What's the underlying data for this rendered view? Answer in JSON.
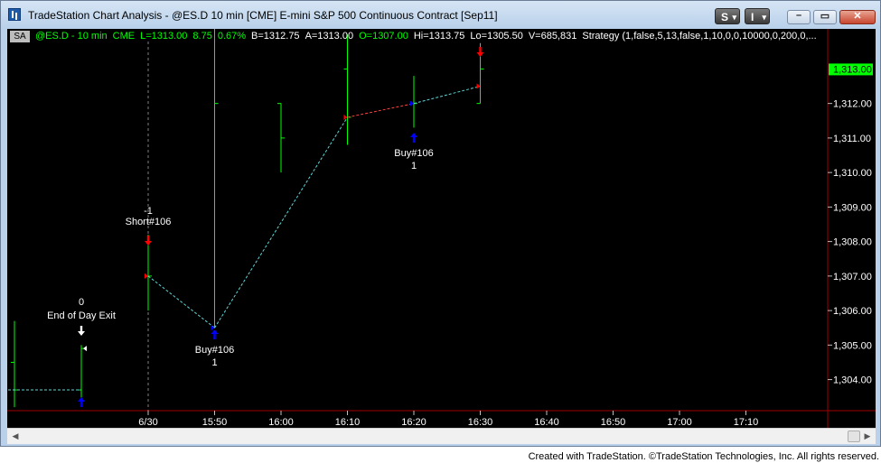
{
  "window": {
    "title": "TradeStation Chart Analysis - @ES.D 10 min [CME] E-mini S&P 500 Continuous Contract [Sep11]",
    "s_button": "S",
    "i_button": "I",
    "minimize_glyph": "–",
    "maximize_glyph": "▭",
    "close_glyph": "✕"
  },
  "header": {
    "sa_label": "SA",
    "symbol": "@ES.D - 10 min",
    "exchange": "CME",
    "last": "L=1313.00",
    "change": "8.75",
    "pct": "0.67%",
    "bid": "B=1312.75",
    "ask": "A=1313.00",
    "open": "O=1307.00",
    "high": "Hi=1313.75",
    "low": "Lo=1305.50",
    "volume": "V=685,831",
    "strategy": "Strategy (1,false,5,13,false,1,10,0,0,10000,0,200,0,..."
  },
  "colors": {
    "background": "#000000",
    "bar": "#00ff00",
    "trade_line_up": "#5fd3d3",
    "trade_line_short": "#ff4040",
    "buy_arrow": "#0000ff",
    "sell_arrow": "#ff0000",
    "exit_arrow": "#ffffff",
    "price_marker": "#00ff00",
    "axis": "#a00000",
    "credit_text": "#000000"
  },
  "chart_data": {
    "type": "ohlc",
    "price_marker": "1,313.00",
    "ylim": [
      1303.1,
      1313.9
    ],
    "y_ticks": [
      {
        "value": 1304,
        "label": "1,304.00"
      },
      {
        "value": 1305,
        "label": "1,305.00"
      },
      {
        "value": 1306,
        "label": "1,306.00"
      },
      {
        "value": 1307,
        "label": "1,307.00"
      },
      {
        "value": 1308,
        "label": "1,308.00"
      },
      {
        "value": 1309,
        "label": "1,309.00"
      },
      {
        "value": 1310,
        "label": "1,310.00"
      },
      {
        "value": 1311,
        "label": "1,311.00"
      },
      {
        "value": 1312,
        "label": "1,312.00"
      }
    ],
    "x_ticks": [
      "6/30",
      "15:50",
      "16:00",
      "16:10",
      "16:20",
      "16:30",
      "16:40",
      "16:50",
      "17:00",
      "17:10"
    ],
    "bars": [
      {
        "time": "15:20",
        "open": 1304.5,
        "high": 1305.7,
        "low": 1303.2,
        "close": 1303.7
      },
      {
        "time": "15:30",
        "open": 1303.7,
        "high": 1305.0,
        "low": 1303.4,
        "close": 1304.9
      },
      {
        "time": "15:40",
        "open": 1307.0,
        "high": 1308.2,
        "low": 1306.0,
        "close": 1307.0
      },
      {
        "time": "15:50",
        "open": 1305.5,
        "high": 1315.0,
        "low": 1305.5,
        "close": 1312.0
      },
      {
        "time": "16:00",
        "open": 1312.0,
        "high": 1312.0,
        "low": 1310.0,
        "close": 1311.0
      },
      {
        "time": "16:10",
        "open": 1313.0,
        "high": 1314.0,
        "low": 1310.8,
        "close": 1311.6
      },
      {
        "time": "16:20",
        "open": 1312.0,
        "high": 1312.8,
        "low": 1311.3,
        "close": 1312.0
      },
      {
        "time": "16:30",
        "open": 1312.0,
        "high": 1313.75,
        "low": 1312.0,
        "close": 1313.0
      }
    ],
    "trades": [
      {
        "label": "End of Day Exit",
        "position": "0",
        "time": "15:30",
        "price": 1304.9,
        "direction": "exit"
      },
      {
        "label": "Short#106",
        "position": "-1",
        "time": "15:40",
        "price": 1307.0,
        "direction": "short"
      },
      {
        "label": "Buy#106",
        "position": "1",
        "time": "15:50",
        "price": 1305.5,
        "direction": "buy"
      },
      {
        "label": "Buy#106",
        "position": "1",
        "time": "16:20",
        "price": 1312.0,
        "direction": "buy"
      }
    ]
  },
  "scrollbar": {
    "left_arrow": "◀",
    "right_arrow": "▶"
  },
  "footer": {
    "credit": "Created with TradeStation. ©TradeStation Technologies, Inc. All rights reserved."
  }
}
